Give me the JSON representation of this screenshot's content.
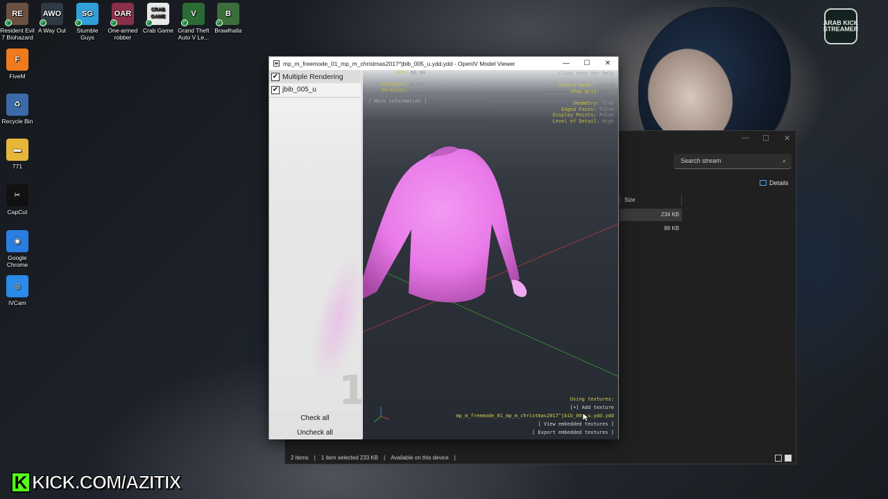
{
  "desktop": {
    "icons": [
      {
        "id": "resident-evil",
        "label": "Resident Evil 7 Biohazard",
        "color": "#6b5040",
        "glyph": "RE"
      },
      {
        "id": "a-way-out",
        "label": "A Way Out",
        "color": "#2f3a44",
        "glyph": "AWO"
      },
      {
        "id": "stumble-guys",
        "label": "Stumble Guys",
        "color": "#2fa0d8",
        "glyph": "SG"
      },
      {
        "id": "one-armed-robber",
        "label": "One-armed robber",
        "color": "#8a2f4a",
        "glyph": "OAR"
      },
      {
        "id": "crab-game",
        "label": "Crab Game",
        "color": "#e8e8e8",
        "glyph": "CRAB GAME"
      },
      {
        "id": "gta5",
        "label": "Grand Theft Auto V Le...",
        "color": "#2c6b36",
        "glyph": "V"
      },
      {
        "id": "brawlhalla",
        "label": "Brawlhalla",
        "color": "#3c6e3c",
        "glyph": "B"
      },
      {
        "id": "fivem",
        "label": "FiveM",
        "color": "#f07a1e",
        "glyph": "F"
      },
      {
        "id": "recycle-bin",
        "label": "Recycle Bin",
        "color": "#3a6aa8",
        "glyph": "♻"
      },
      {
        "id": "folder-771",
        "label": "771",
        "color": "#e6b63a",
        "glyph": "▬"
      },
      {
        "id": "capcut",
        "label": "CapCut",
        "color": "#111111",
        "glyph": "✂"
      },
      {
        "id": "google-chrome",
        "label": "Google Chrome",
        "color": "#2a7de1",
        "glyph": "◉"
      },
      {
        "id": "ivcam",
        "label": "iVCam",
        "color": "#2a8be8",
        "glyph": "◎"
      }
    ],
    "badge_text": "ARAB KICK STREAMER",
    "banner": {
      "k": "K",
      "text": "KICK.COM/AZITIX"
    }
  },
  "explorer": {
    "controls": [
      "—",
      "☐",
      "✕"
    ],
    "search_placeholder": "Search stream",
    "details_label": "Details",
    "size_header": "Size",
    "rows": [
      {
        "size": "234 KB",
        "selected": true
      },
      {
        "size": "89 KB",
        "selected": false
      }
    ],
    "status": {
      "items": "2 items",
      "selected": "1 item selected  233 KB",
      "availability": "Available on this device"
    }
  },
  "viewer": {
    "title": "mp_m_freemode_01_mp_m_christmas2017^jbib_005_u.ydd.ydd - OpenIV Model Viewer",
    "controls": {
      "minimize": "—",
      "maximize": "☐",
      "close": "✕"
    },
    "list": [
      {
        "label": "Multiple Rendering",
        "checked": true
      },
      {
        "label": "jbib_005_u",
        "checked": true
      }
    ],
    "watermark_number": "1",
    "buttons": {
      "check_all": "Check all",
      "uncheck_all": "Uncheck all"
    },
    "hud": {
      "fps": {
        "k": "FPS:",
        "v": "60.04"
      },
      "polygons": {
        "k": "Polygons:",
        "v": "3,910"
      },
      "vertices": {
        "k": "Vertices:",
        "v": "2,348"
      },
      "more_info": "[ More information ]",
      "help": "Click here for help",
      "right": [
        {
          "k": "Camera mode:",
          "v": "Around"
        },
        {
          "k": "Show grid:",
          "v": "True"
        },
        {
          "k": "Geometry:",
          "v": "True"
        },
        {
          "k": "Edged Faces:",
          "v": "False"
        },
        {
          "k": "Display Points:",
          "v": "False"
        },
        {
          "k": "Level of Detail:",
          "v": "High"
        }
      ],
      "textures": {
        "using": "Using textures:",
        "add": "[+] Add texture",
        "file": "mp_m_freemode_01_mp_m_christmas2017^jbib_005_u.ydd.ydd",
        "view": "[ View embedded textures ]",
        "export": "[ Export embedded textures ]"
      }
    },
    "colors": {
      "mesh": "#e879e8",
      "hud_key": "#c8c33a",
      "grid_red": "#b83a3a",
      "grid_green": "#3a9a3a"
    }
  }
}
